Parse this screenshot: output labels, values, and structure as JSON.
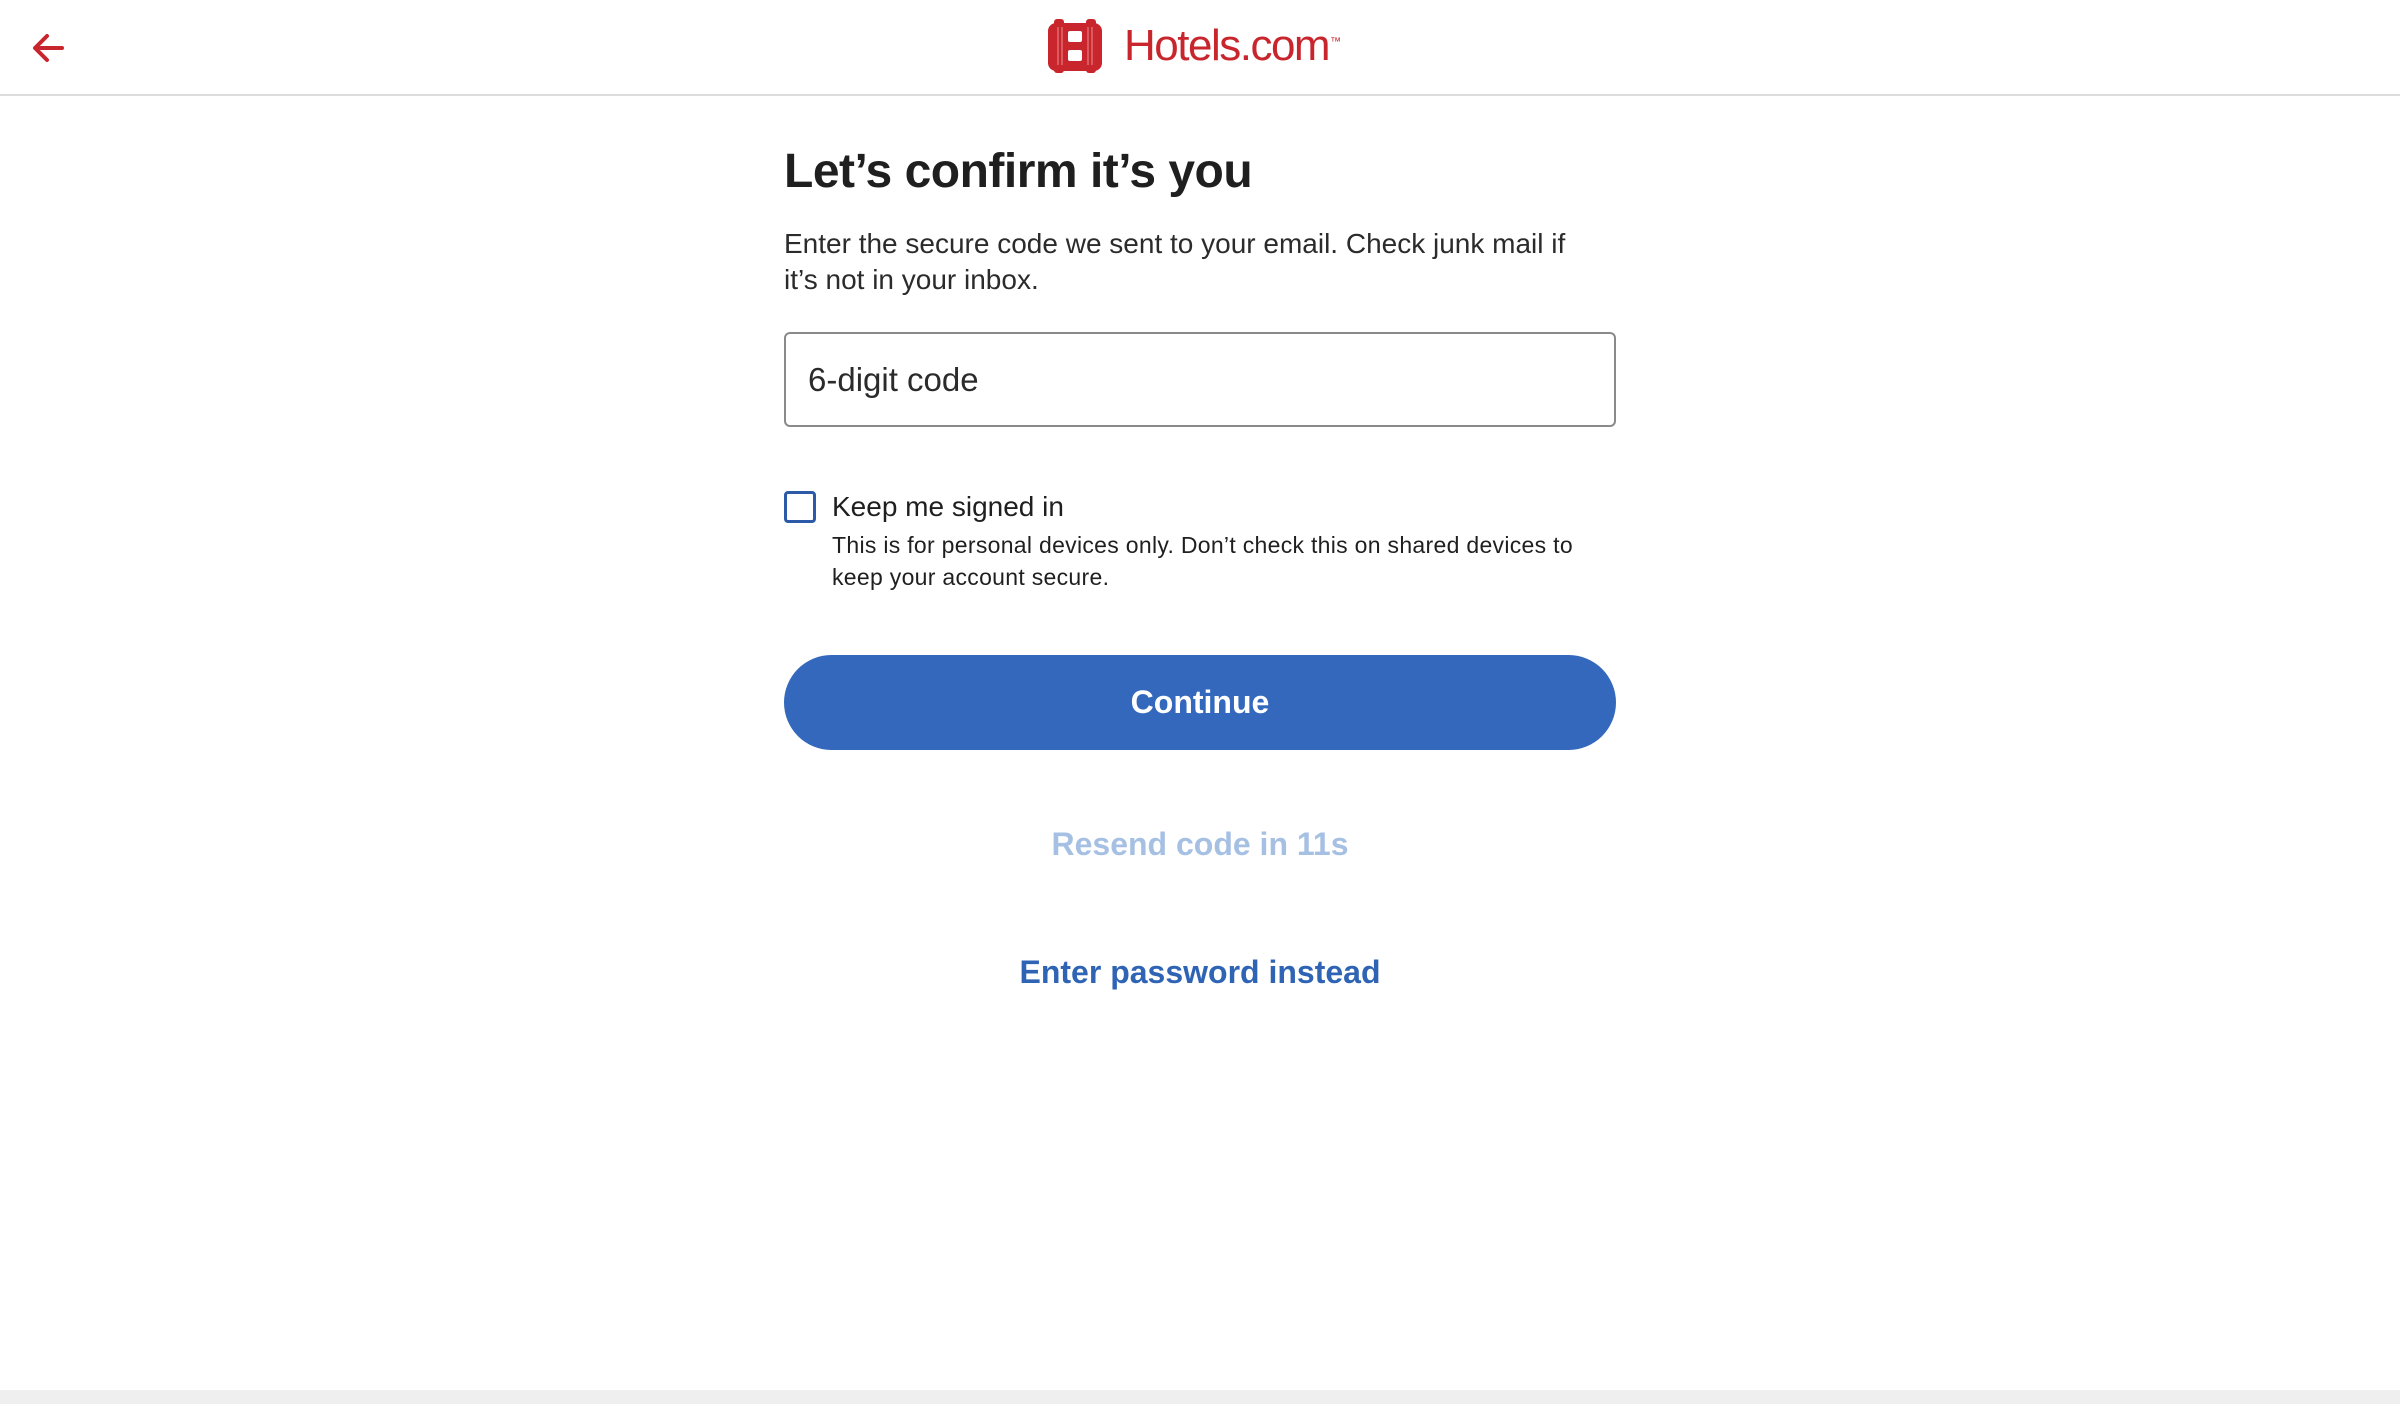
{
  "header": {
    "back_icon": "arrow-left-icon",
    "logo_text": "Hotels.com",
    "logo_tm": "™",
    "brand_color": "#c8262c"
  },
  "form": {
    "title": "Let’s confirm it’s you",
    "subtitle": "Enter the secure code we sent to your email. Check junk mail if it’s not in your inbox.",
    "code_input": {
      "placeholder": "6-digit code",
      "value": ""
    },
    "keep_signed_in": {
      "label": "Keep me signed in",
      "help": "This is for personal devices only. Don’t check this on shared devices to keep your account secure.",
      "checked": false
    },
    "continue_label": "Continue",
    "resend_label": "Resend code in 11s",
    "password_link": "Enter password instead"
  },
  "colors": {
    "primary": "#3368bd",
    "link": "#2f64b5",
    "disabled_link": "#a6c0e3",
    "checkbox_border": "#2c5aa8"
  }
}
